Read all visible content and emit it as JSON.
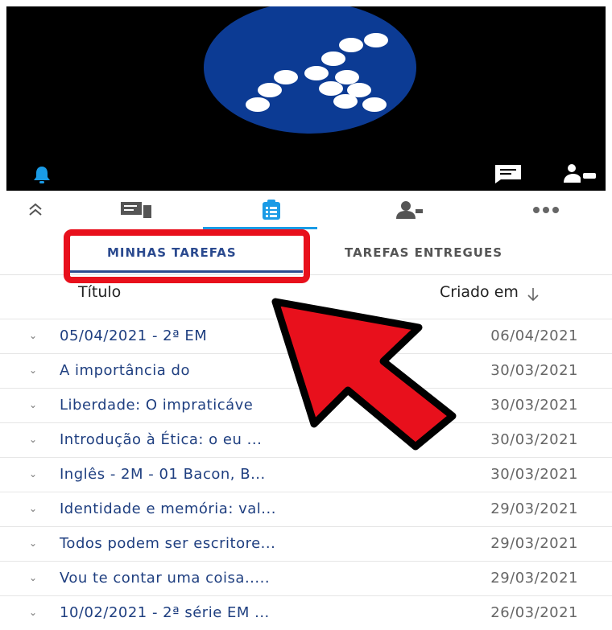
{
  "toolbar": {
    "items": [
      {
        "name": "collapse",
        "icon": "chevron-up-double-icon"
      },
      {
        "name": "posts",
        "icon": "chat-board-icon"
      },
      {
        "name": "assignments",
        "icon": "clipboard-list-icon",
        "active": true
      },
      {
        "name": "members",
        "icon": "person-icon"
      },
      {
        "name": "more",
        "icon": "more-dots-icon"
      }
    ]
  },
  "subtabs": {
    "mine": "MINHAS TAREFAS",
    "delivered": "TAREFAS ENTREGUES"
  },
  "table": {
    "col_title": "Título",
    "col_created": "Criado em",
    "sort_icon": "arrow-down-icon",
    "rows": [
      {
        "title": "05/04/2021 - 2ª EM",
        "date": "06/04/2021"
      },
      {
        "title": "A importância do",
        "date": "30/03/2021"
      },
      {
        "title": "Liberdade: O impraticáve",
        "date": "30/03/2021"
      },
      {
        "title": "Introdução à Ética: o eu ...",
        "date": "30/03/2021"
      },
      {
        "title": "Inglês - 2M - 01 Bacon, B...",
        "date": "30/03/2021"
      },
      {
        "title": "Identidade e memória: val...",
        "date": "29/03/2021"
      },
      {
        "title": "Todos podem ser escritore...",
        "date": "29/03/2021"
      },
      {
        "title": "Vou te contar uma coisa.....",
        "date": "29/03/2021"
      },
      {
        "title": "10/02/2021 - 2ª série EM ...",
        "date": "26/03/2021"
      }
    ]
  },
  "colors": {
    "accent": "#1a9be6",
    "tab_active": "#2b4a8f",
    "highlight": "#e8101c",
    "logo_bg": "#0c3b94"
  }
}
